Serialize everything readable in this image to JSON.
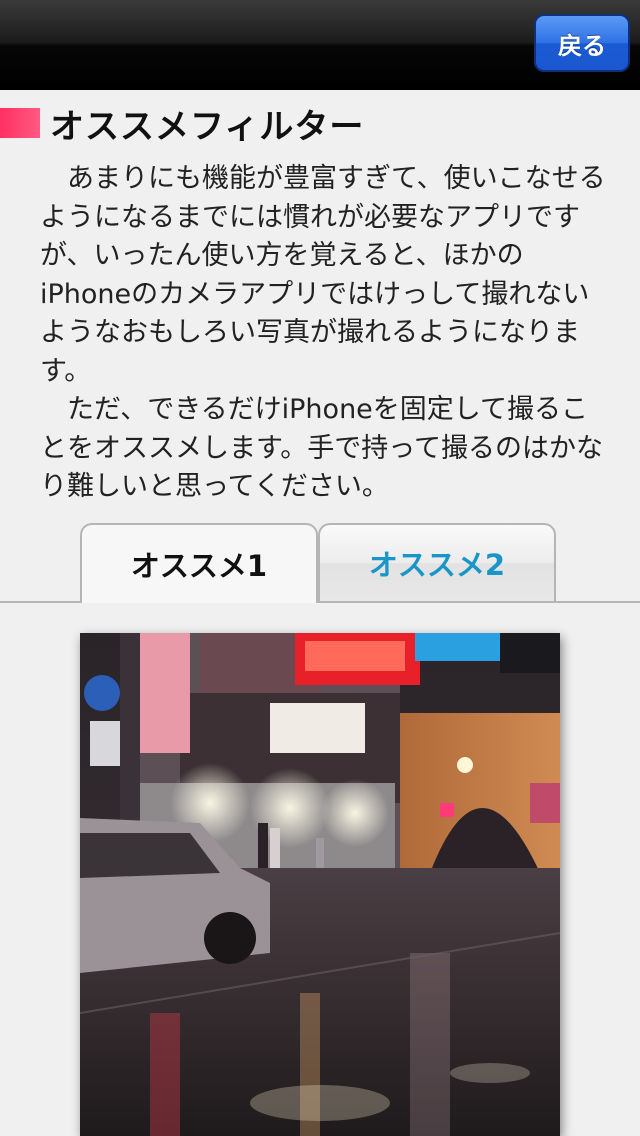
{
  "nav": {
    "back_label": "戻る"
  },
  "section": {
    "title": "オススメフィルター"
  },
  "body": {
    "paragraph1": "　あまりにも機能が豊富すぎて、使いこなせるようになるまでには慣れが必要なアプリですが、いったん使い方を覚えると、ほかのiPhoneのカメラアプリではけっして撮れないようなおもしろい写真が撮れるようになります。",
    "paragraph2": "　ただ、できるだけiPhoneを固定して撮ることをオススメします。手で持って撮るのはかなり難しいと思ってください。"
  },
  "tabs": [
    {
      "label": "オススメ1",
      "selected": true
    },
    {
      "label": "オススメ2",
      "selected": false
    }
  ],
  "colors": {
    "accent_pink": "#ff2f63",
    "tab_inactive_text": "#1a95c8",
    "back_button": "#2f71e6"
  }
}
